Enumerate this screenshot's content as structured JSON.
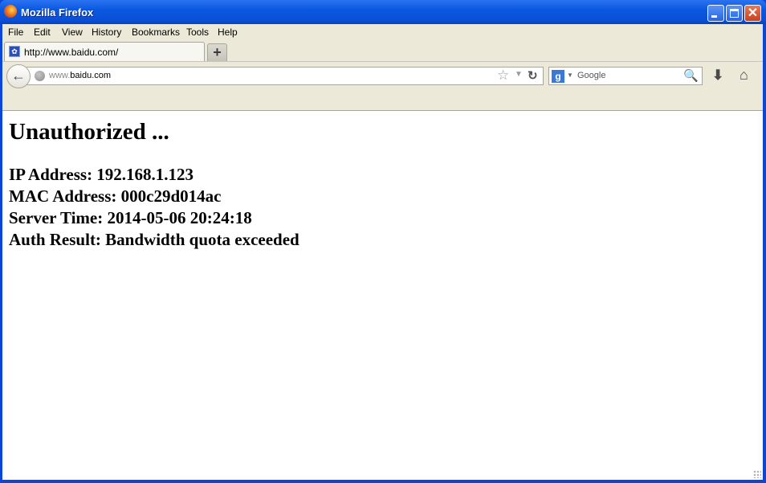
{
  "window": {
    "title": "Mozilla Firefox",
    "controls": {
      "minimize": "_",
      "maximize": "□",
      "close": "✕"
    }
  },
  "menubar": {
    "items": [
      {
        "label": "File"
      },
      {
        "label": "Edit"
      },
      {
        "label": "View"
      },
      {
        "label": "History"
      },
      {
        "label": "Bookmarks"
      },
      {
        "label": "Tools"
      },
      {
        "label": "Help"
      }
    ]
  },
  "tabs": [
    {
      "label": "http://www.baidu.com/",
      "icon": "baidu-paw-icon",
      "active": true
    }
  ],
  "newtab": {
    "label": "+"
  },
  "navbar": {
    "back_label": "←",
    "url_prefix": "www.",
    "url_rest": "baidu.com",
    "star_glyph": "☆",
    "dropdown_glyph": "▼",
    "reload_glyph": "↻",
    "search": {
      "engine_glyph": "g",
      "dropdown_glyph": "▼",
      "placeholder": "Google",
      "magnifier_glyph": "🔍"
    },
    "download_glyph": "⬇",
    "home_glyph": "⌂"
  },
  "page": {
    "heading": "Unauthorized ...",
    "fields": [
      {
        "text": "IP Address: 192.168.1.123"
      },
      {
        "text": "MAC Address: 000c29d014ac"
      },
      {
        "text": "Server Time: 2014-05-06 20:24:18"
      },
      {
        "text": "Auth Result: Bandwidth quota exceeded"
      }
    ]
  }
}
